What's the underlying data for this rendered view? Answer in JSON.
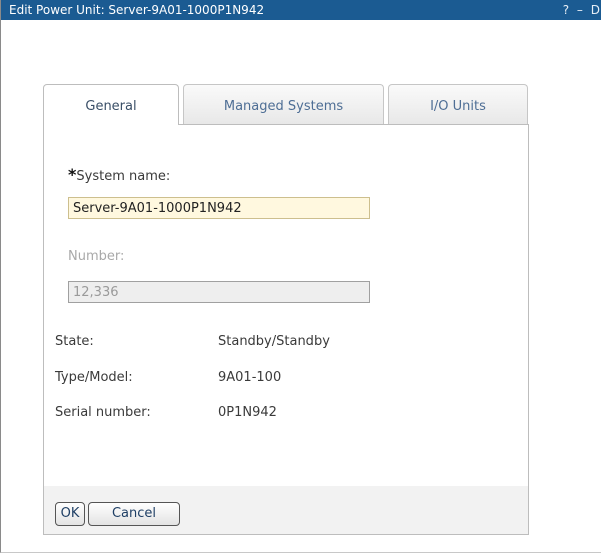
{
  "window": {
    "title": "Edit Power Unit: Server-9A01-1000P1N942",
    "controls": {
      "help": "?",
      "minimize": "–",
      "restore": "D"
    }
  },
  "tabs": [
    {
      "label": "General",
      "active": true
    },
    {
      "label": "Managed Systems",
      "active": false
    },
    {
      "label": "I/O Units",
      "active": false
    }
  ],
  "general": {
    "system_name": {
      "required_mark": "*",
      "label": "System name:",
      "value": "Server-9A01-1000P1N942"
    },
    "number": {
      "label": "Number:",
      "value": "12,336",
      "disabled": true
    },
    "state": {
      "label": "State:",
      "value": "Standby/Standby"
    },
    "type_model": {
      "label": "Type/Model:",
      "value": "9A01-100"
    },
    "serial": {
      "label": "Serial number:",
      "value": "0P1N942"
    }
  },
  "buttons": {
    "ok": "OK",
    "cancel": "Cancel"
  },
  "colors": {
    "titlebar": "#1b5b92",
    "required_input_bg": "#fff8df",
    "tab_text": "#4e6e95"
  }
}
